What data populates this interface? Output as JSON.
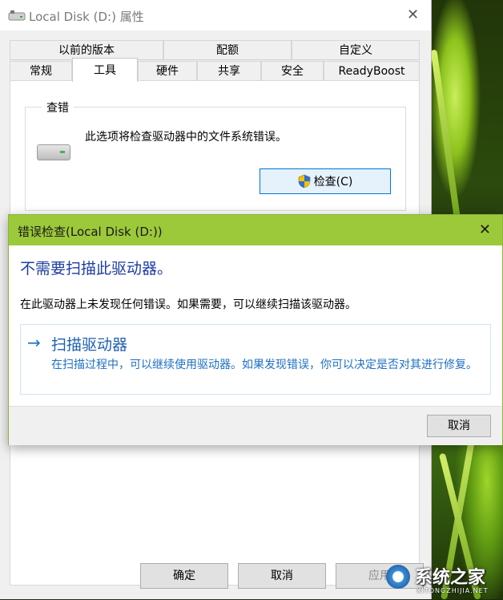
{
  "properties_window": {
    "title": "Local Disk (D:) 属性",
    "close_glyph": "✕",
    "tabs_top": [
      "以前的版本",
      "配额",
      "自定义"
    ],
    "tabs_bottom": [
      "常规",
      "工具",
      "硬件",
      "共享",
      "安全",
      "ReadyBoost"
    ],
    "active_tab": "工具",
    "error_check_group": {
      "label": "查错",
      "description": "此选项将检查驱动器中的文件系统错误。",
      "check_button": "检查(C)"
    },
    "buttons": {
      "ok": "确定",
      "cancel": "取消",
      "apply": "应用"
    }
  },
  "error_check_dialog": {
    "title": "错误检查(Local Disk (D:))",
    "close_glyph": "✕",
    "heading": "不需要扫描此驱动器。",
    "message": "在此驱动器上未发现任何错误。如果需要，可以继续扫描该驱动器。",
    "scan_option": {
      "arrow": "→",
      "title": "扫描驱动器",
      "description": "在扫描过程中，可以继续使用驱动器。如果发现错误，你可以决定是否对其进行修复。"
    },
    "cancel_button": "取消"
  },
  "watermark": {
    "text": "系统之家",
    "subtext": "XITONGZHIJIA.NET"
  },
  "colors": {
    "dialog_titlebar": "#9cc93a",
    "heading_blue": "#1e3da0",
    "link_blue": "#1e6fc3",
    "accent_blue": "#0078d7"
  },
  "icons": {
    "title_drive": "drive-icon",
    "group_drive": "hard-drive-icon",
    "uac_shield": "uac-shield-icon",
    "close": "close-icon",
    "arrow": "arrow-right-icon"
  }
}
